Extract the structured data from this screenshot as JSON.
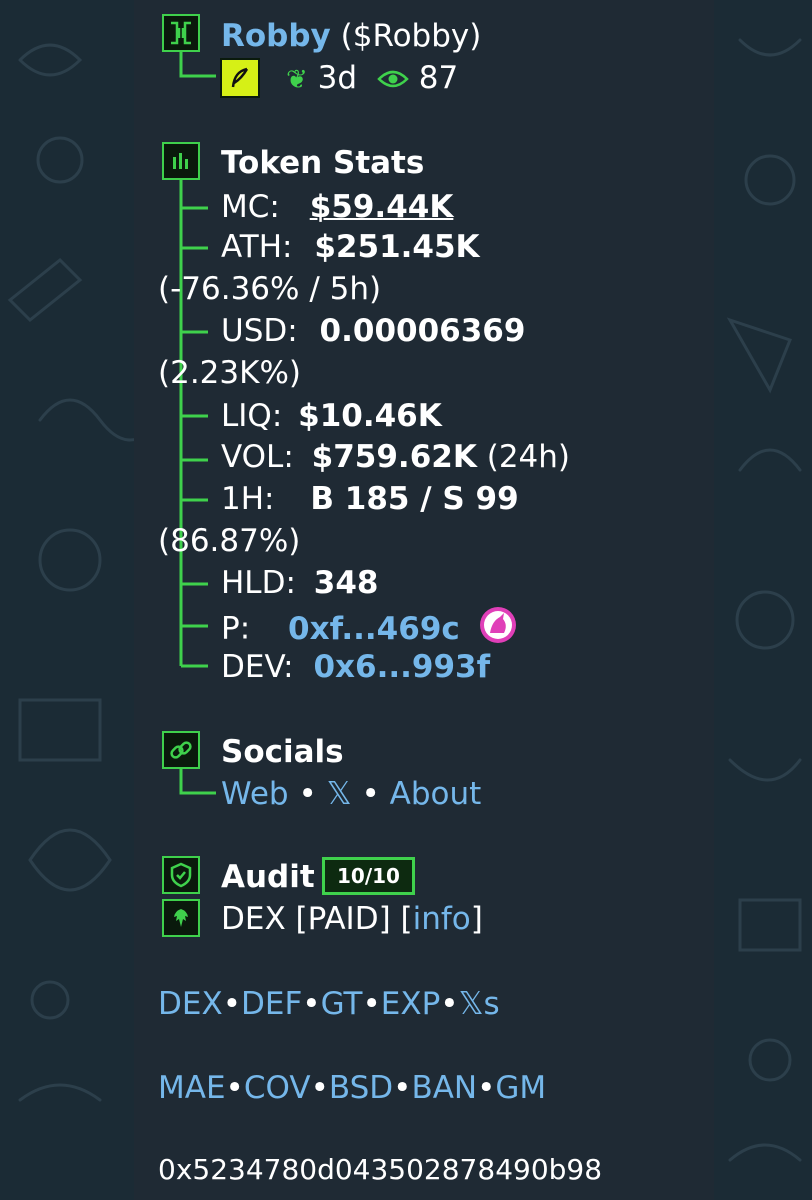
{
  "colors": {
    "accent": "#3fd14c",
    "link": "#75b7ea",
    "bubble": "#1f2a34",
    "background": "#1b2b35"
  },
  "icons": {
    "header": "token-badge-icon",
    "feather": "feather-pen-icon",
    "sprout": "sprout-icon",
    "eye": "eye-icon",
    "stats": "bar-chart-icon",
    "socials": "link-icon",
    "audit": "shield-check-icon",
    "dex": "eagle-icon",
    "pair": "unicorn-dex-icon"
  },
  "header": {
    "name": "Robby",
    "ticker": "($Robby)",
    "age": "3d",
    "views": "87"
  },
  "stats": {
    "title": "Token Stats",
    "mc_label": "MC:",
    "mc_value": "$59.44K",
    "ath_label": "ATH:",
    "ath_value": "$251.45K",
    "ath_sub": "(-76.36% / 5h)",
    "usd_label": "USD:",
    "usd_value": "0.00006369",
    "usd_sub": "(2.23K%)",
    "liq_label": "LIQ:",
    "liq_value": "$10.46K",
    "vol_label": "VOL:",
    "vol_value": "$759.62K",
    "vol_period": "(24h)",
    "h1_label": "1H:",
    "h1_value": "B 185 / S 99",
    "h1_sub": "(86.87%)",
    "hld_label": "HLD:",
    "hld_value": "348",
    "p_label": "P:",
    "p_value": "0xf...469c",
    "dev_label": "DEV:",
    "dev_value": "0x6...993f"
  },
  "socials": {
    "title": "Socials",
    "web": "Web",
    "x": "𝕏",
    "about": "About",
    "sep": "•"
  },
  "audit": {
    "title": "Audit",
    "score": "10/10",
    "dex_text": "DEX [PAID] [",
    "info": "info",
    "close": "]"
  },
  "links_row1": [
    "DEX",
    "DEF",
    "GT",
    "EXP",
    "𝕏s"
  ],
  "links_row2": [
    "MAE",
    "COV",
    "BSD",
    "BAN",
    "GM"
  ],
  "sep": "•",
  "contract": "0x5234780d043502878490b98"
}
